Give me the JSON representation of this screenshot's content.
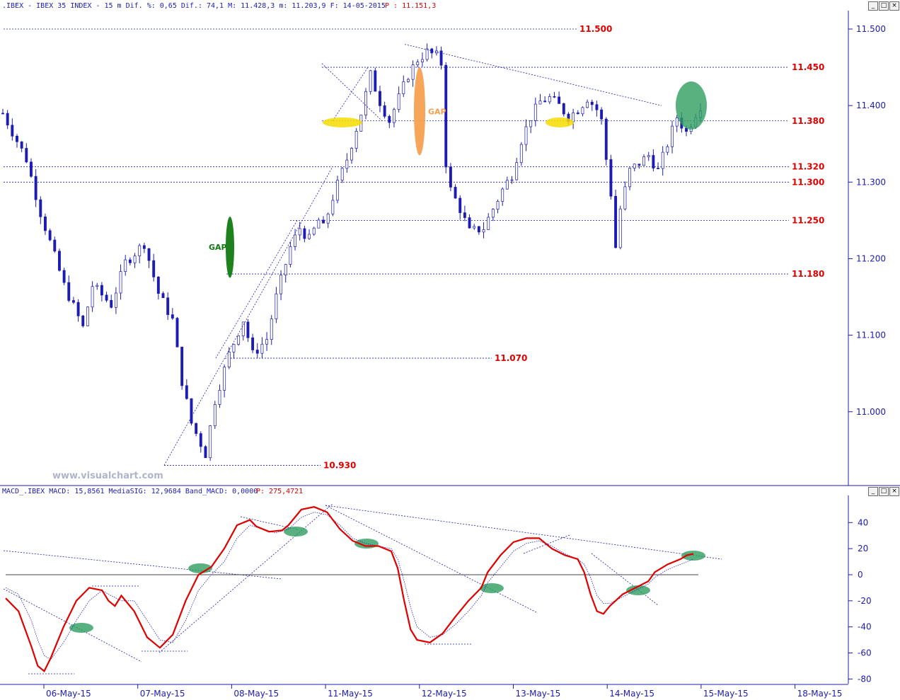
{
  "price_panel": {
    "header": {
      "instrument": ".IBEX - IBEX 35 INDEX -  15 m Dif. %: 0,65 Dif.: 74,1 M: 11.428,3 m: 11.203,9 F: 14-05-2015",
      "last": " P : 11.151,3"
    },
    "watermark": "www.visualchart.com",
    "gap_label": "GAP"
  },
  "macd_panel": {
    "header": {
      "instrument": "MACD_.IBEX MACD: 15,8561 MediaSIG: 12,9684 Band_MACD: 0,0000",
      "last": " P: 275,4721"
    }
  },
  "window_buttons": [
    "_",
    "□",
    "×"
  ],
  "chart_data": [
    {
      "type": "candlestick",
      "ylim": [
        10900,
        11550
      ],
      "yticks": [
        11500,
        11400,
        11300,
        11200,
        11100,
        11000
      ],
      "ytick_labels": [
        "11.500",
        "11.400",
        "11.300",
        "11.200",
        "11.100",
        "11.000"
      ],
      "x": [
        "06-May-15",
        "07-May-15",
        "08-May-15",
        "11-May-15",
        "12-May-15",
        "13-May-15",
        "14-May-15",
        "15-May-15",
        "18-May-15"
      ],
      "levels": [
        {
          "value": 11500,
          "label": "11.500"
        },
        {
          "value": 11450,
          "label": "11.450"
        },
        {
          "value": 11380,
          "label": "11.380"
        },
        {
          "value": 11320,
          "label": "11.320"
        },
        {
          "value": 11300,
          "label": "11.300"
        },
        {
          "value": 11250,
          "label": "11.250"
        },
        {
          "value": 11180,
          "label": "11.180"
        },
        {
          "value": 11070,
          "label": "11.070"
        },
        {
          "value": 10930,
          "label": "10.930"
        }
      ],
      "path": [
        [
          0,
          11390
        ],
        [
          5,
          11330
        ],
        [
          8,
          11260
        ],
        [
          13,
          11165
        ],
        [
          17,
          11110
        ],
        [
          19,
          11165
        ],
        [
          23,
          11140
        ],
        [
          26,
          11195
        ],
        [
          30,
          11220
        ],
        [
          33,
          11155
        ],
        [
          36,
          11120
        ],
        [
          38,
          11040
        ],
        [
          40,
          10985
        ],
        [
          43,
          10945
        ],
        [
          45,
          11015
        ],
        [
          48,
          11075
        ],
        [
          51,
          11120
        ],
        [
          53,
          11075
        ],
        [
          56,
          11095
        ],
        [
          58,
          11150
        ],
        [
          61,
          11215
        ],
        [
          63,
          11240
        ],
        [
          65,
          11225
        ],
        [
          67,
          11250
        ],
        [
          68,
          11240
        ],
        [
          70,
          11280
        ],
        [
          73,
          11330
        ],
        [
          76,
          11390
        ],
        [
          78,
          11440
        ],
        [
          80,
          11405
        ],
        [
          82,
          11380
        ],
        [
          84,
          11410
        ],
        [
          86,
          11440
        ],
        [
          88,
          11460
        ],
        [
          90,
          11470
        ],
        [
          92,
          11465
        ],
        [
          93,
          11455
        ],
        [
          94,
          11325
        ],
        [
          95,
          11290
        ],
        [
          97,
          11265
        ],
        [
          99,
          11235
        ],
        [
          102,
          11240
        ],
        [
          104,
          11265
        ],
        [
          106,
          11290
        ],
        [
          108,
          11310
        ],
        [
          110,
          11355
        ],
        [
          112,
          11385
        ],
        [
          114,
          11405
        ],
        [
          116,
          11410
        ],
        [
          118,
          11400
        ],
        [
          120,
          11385
        ],
        [
          122,
          11395
        ],
        [
          124,
          11410
        ],
        [
          126,
          11395
        ],
        [
          127,
          11380
        ],
        [
          128,
          11330
        ],
        [
          129,
          11285
        ],
        [
          130,
          11215
        ],
        [
          131,
          11265
        ],
        [
          133,
          11315
        ],
        [
          135,
          11325
        ],
        [
          137,
          11335
        ],
        [
          139,
          11315
        ],
        [
          141,
          11350
        ],
        [
          143,
          11385
        ],
        [
          145,
          11365
        ],
        [
          147,
          11390
        ],
        [
          148,
          11400
        ]
      ],
      "gaps": [
        {
          "label": "GAP",
          "color": "#117a11",
          "from": 11175,
          "to": 11255
        },
        {
          "label": "GAP",
          "color": "#f5a050",
          "from": 11335,
          "to": 11450
        }
      ]
    },
    {
      "type": "line",
      "ylim": [
        -85,
        58
      ],
      "yticks": [
        40,
        20,
        0,
        -20,
        -40,
        -60,
        -80
      ],
      "series": [
        {
          "color": "#e00000",
          "path": [
            [
              0,
              -18
            ],
            [
              2,
              -28
            ],
            [
              4,
              -55
            ],
            [
              5,
              -70
            ],
            [
              6,
              -74
            ],
            [
              7,
              -64
            ],
            [
              9,
              -40
            ],
            [
              11,
              -20
            ],
            [
              13,
              -10
            ],
            [
              15,
              -12
            ],
            [
              16,
              -20
            ],
            [
              17,
              -24
            ],
            [
              18,
              -16
            ],
            [
              20,
              -28
            ],
            [
              22,
              -48
            ],
            [
              24,
              -56
            ],
            [
              26,
              -46
            ],
            [
              28,
              -20
            ],
            [
              30,
              0
            ],
            [
              32,
              6
            ],
            [
              34,
              20
            ],
            [
              36,
              38
            ],
            [
              38,
              42
            ],
            [
              39,
              37
            ],
            [
              41,
              33
            ],
            [
              43,
              34
            ],
            [
              44,
              38
            ],
            [
              46,
              50
            ],
            [
              48,
              52
            ],
            [
              50,
              48
            ],
            [
              52,
              35
            ],
            [
              54,
              26
            ],
            [
              56,
              22
            ],
            [
              58,
              22
            ],
            [
              60,
              18
            ],
            [
              61,
              5
            ],
            [
              62,
              -20
            ],
            [
              63,
              -42
            ],
            [
              64,
              -50
            ],
            [
              66,
              -52
            ],
            [
              68,
              -45
            ],
            [
              70,
              -32
            ],
            [
              72,
              -20
            ],
            [
              74,
              -10
            ],
            [
              75,
              2
            ],
            [
              77,
              15
            ],
            [
              79,
              25
            ],
            [
              81,
              28
            ],
            [
              83,
              28
            ],
            [
              85,
              20
            ],
            [
              87,
              15
            ],
            [
              89,
              12
            ],
            [
              90,
              2
            ],
            [
              91,
              -15
            ],
            [
              92,
              -28
            ],
            [
              93,
              -30
            ],
            [
              94,
              -24
            ],
            [
              96,
              -15
            ],
            [
              98,
              -10
            ],
            [
              100,
              -5
            ],
            [
              101,
              2
            ],
            [
              103,
              8
            ],
            [
              105,
              12
            ],
            [
              106,
              15
            ],
            [
              107,
              16
            ]
          ]
        },
        {
          "color": "#2020c0",
          "path": [
            [
              0,
              -10
            ],
            [
              2,
              -15
            ],
            [
              4,
              -35
            ],
            [
              5,
              -50
            ],
            [
              6,
              -62
            ],
            [
              7,
              -65
            ],
            [
              9,
              -52
            ],
            [
              11,
              -35
            ],
            [
              13,
              -20
            ],
            [
              15,
              -12
            ],
            [
              16,
              -15
            ],
            [
              18,
              -20
            ],
            [
              20,
              -20
            ],
            [
              22,
              -35
            ],
            [
              24,
              -50
            ],
            [
              26,
              -52
            ],
            [
              28,
              -35
            ],
            [
              30,
              -12
            ],
            [
              32,
              0
            ],
            [
              34,
              10
            ],
            [
              36,
              28
            ],
            [
              38,
              38
            ],
            [
              40,
              35
            ],
            [
              42,
              32
            ],
            [
              44,
              35
            ],
            [
              46,
              44
            ],
            [
              48,
              48
            ],
            [
              50,
              46
            ],
            [
              52,
              38
            ],
            [
              54,
              28
            ],
            [
              56,
              24
            ],
            [
              58,
              22
            ],
            [
              60,
              20
            ],
            [
              61,
              12
            ],
            [
              62,
              -5
            ],
            [
              63,
              -25
            ],
            [
              64,
              -40
            ],
            [
              66,
              -48
            ],
            [
              68,
              -46
            ],
            [
              70,
              -38
            ],
            [
              72,
              -28
            ],
            [
              74,
              -16
            ],
            [
              75,
              -6
            ],
            [
              77,
              6
            ],
            [
              79,
              18
            ],
            [
              81,
              24
            ],
            [
              83,
              26
            ],
            [
              85,
              22
            ],
            [
              87,
              16
            ],
            [
              89,
              12
            ],
            [
              90,
              8
            ],
            [
              91,
              -2
            ],
            [
              92,
              -16
            ],
            [
              93,
              -22
            ],
            [
              94,
              -22
            ],
            [
              96,
              -17
            ],
            [
              98,
              -12
            ],
            [
              100,
              -7
            ],
            [
              101,
              -2
            ],
            [
              103,
              4
            ],
            [
              105,
              8
            ],
            [
              107,
              12
            ]
          ]
        }
      ]
    }
  ]
}
